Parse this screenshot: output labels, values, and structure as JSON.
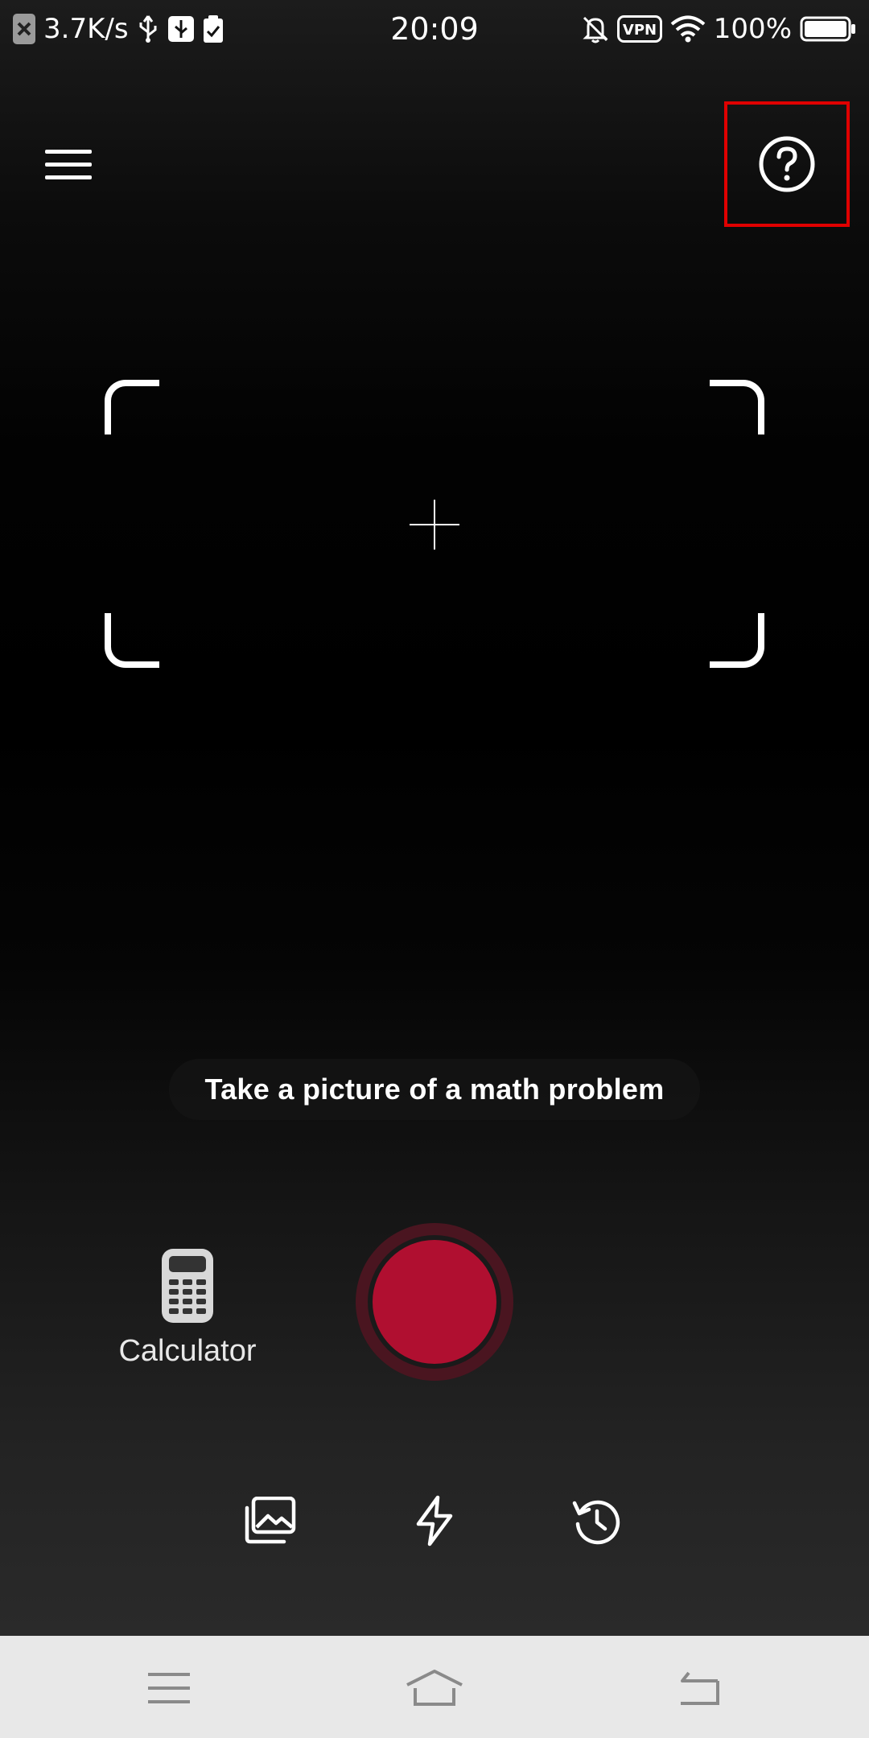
{
  "status_bar": {
    "network_speed": "3.7K/s",
    "time": "20:09",
    "battery_percent": "100%",
    "vpn_label": "VPN",
    "battery_level": 1.0,
    "icons": [
      "close-notification-icon",
      "usb-icon",
      "usb-debugging-icon",
      "clipboard-check-icon",
      "bell-off-icon",
      "vpn-icon",
      "wifi-icon",
      "battery-icon"
    ]
  },
  "toolbar": {
    "menu_icon": "hamburger-menu-icon",
    "help_icon": "help-circle-icon",
    "help_highlight_color": "#e00000"
  },
  "viewfinder": {
    "crosshair_icon": "crosshair-icon"
  },
  "hint": {
    "text": "Take a picture of a math problem"
  },
  "camera_controls": {
    "calculator_label": "Calculator",
    "calculator_icon": "calculator-icon",
    "shutter_color": "#b00f30",
    "bottom_icons": [
      "gallery-icon",
      "flash-icon",
      "history-icon"
    ]
  },
  "nav_bar": {
    "icons": [
      "recents-menu-icon",
      "home-icon",
      "back-icon"
    ]
  }
}
